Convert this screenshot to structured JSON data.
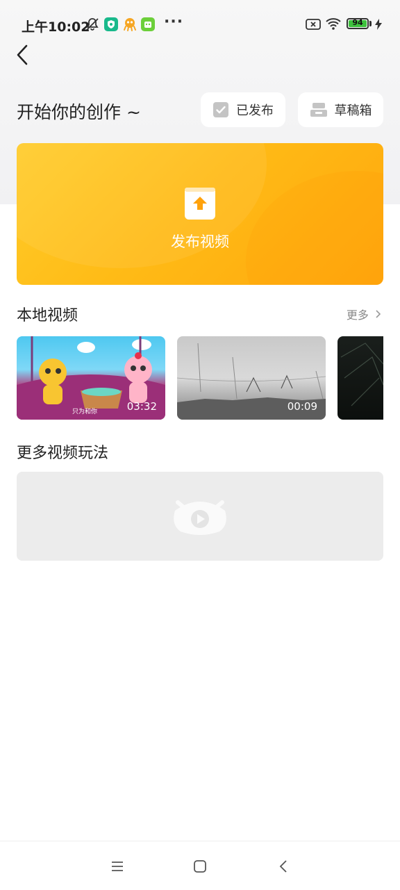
{
  "status_bar": {
    "time": "上午10:02",
    "more": "···",
    "battery": "94"
  },
  "header": {
    "title": "开始你的创作 ~",
    "published_label": "已发布",
    "drafts_label": "草稿箱"
  },
  "publish": {
    "label": "发布视频",
    "colors": {
      "start": "#ffcc2a",
      "end": "#ffa70d"
    }
  },
  "local_videos": {
    "title": "本地视频",
    "more": "更多",
    "items": [
      {
        "duration": "03:32",
        "caption": "只为和你"
      },
      {
        "duration": "00:09"
      },
      {
        "duration": ""
      }
    ]
  },
  "more_section": {
    "title": "更多视频玩法"
  },
  "icons": [
    "back-icon",
    "checkbox-icon",
    "drafts-icon",
    "upload-icon",
    "chevron-right-icon",
    "menu-icon",
    "home-icon",
    "nav-back-icon"
  ]
}
